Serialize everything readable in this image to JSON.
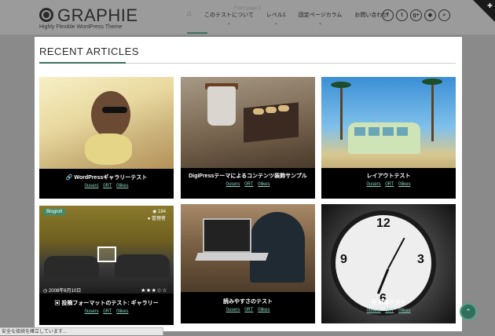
{
  "header": {
    "logo_text": "GRAPHIE",
    "tagline": "Highly Flexible WordPress Theme",
    "breadcrumb": "Front page 1",
    "nav": [
      {
        "label": "",
        "icon": "home-icon",
        "has_dropdown": false
      },
      {
        "label": "このテストについて",
        "has_dropdown": true
      },
      {
        "label": "レベル1",
        "has_dropdown": true
      },
      {
        "label": "固定ページカラム",
        "has_dropdown": true
      },
      {
        "label": "お問い合わせ",
        "has_dropdown": false
      }
    ],
    "social_icons": [
      "facebook-icon",
      "twitter-icon",
      "google-plus-icon",
      "feedly-icon",
      "search-icon"
    ]
  },
  "section": {
    "title": "RECENT ARTICLES",
    "accent_color": "#3d6f5f"
  },
  "articles": [
    {
      "title": "WordPressギャラリーテスト",
      "icon": "link-icon",
      "tags": [
        "0users",
        "0RT",
        "0likes"
      ]
    },
    {
      "title": "DigiPressテーマによるコンテンツ装飾サンプル",
      "icon": "",
      "tags": [
        "0users",
        "0RT",
        "0likes"
      ]
    },
    {
      "title": "レイアウトテスト",
      "icon": "",
      "tags": [
        "0users",
        "0RT",
        "0likes"
      ]
    },
    {
      "title": "投稿フォーマットのテスト: ギャラリー",
      "icon": "gallery-icon",
      "tags": [
        "0users",
        "0RT",
        "0likes"
      ],
      "category_badge": "Blogroll",
      "views": "184",
      "author": "管理者",
      "date": "2008年6月10日",
      "rating": 3.5
    },
    {
      "title": "読みやすさのテスト",
      "icon": "",
      "tags": [
        "0users",
        "0RT",
        "0likes"
      ]
    },
    {
      "title": "画像テスト",
      "icon": "image-icon",
      "tags": [
        "0users",
        "0RT",
        "0likes"
      ]
    }
  ],
  "status_text": "安全な接続を確立しています..."
}
